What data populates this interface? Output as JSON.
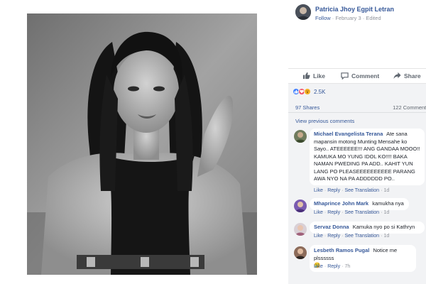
{
  "post": {
    "author": "Patricia Jhoy Egpit Letran",
    "follow": "Follow",
    "date": "February 3",
    "edited": "Edited",
    "meta_dot": "·"
  },
  "actions": {
    "like": "Like",
    "comment": "Comment",
    "share": "Share"
  },
  "stats": {
    "reaction_count": "2.5K",
    "shares": "97 Shares",
    "comments": "122 Comments"
  },
  "view_previous": "View previous comments",
  "comment_actions": {
    "like": "Like",
    "reply": "Reply",
    "see_translation": "See Translation",
    "dot": "·"
  },
  "comments": [
    {
      "name": "Michael Evangelista Terana",
      "text": "Ate sana mapansin motong Munting Mensahe ko Sayo.. ATEEEEEE!!! ANG GANDAA MOOO!! KAMUKA MO YUNG IDOL KO!!!! BAKA NAMAN PWEDING PA ADD.. KAHIT YUN LANG PO PLEASEEEEEEEEEE PARANG AWA NYO NA PA ADDDDDD PO..",
      "time": "1d"
    },
    {
      "name": "Mhaprince John Mark",
      "text": "kamukha nya",
      "time": "1d"
    },
    {
      "name": "Servaz Donna",
      "text": "Kamuka nyo po si Kathryn",
      "time": "1d"
    },
    {
      "name": "Lesbeth Ramos Pugal",
      "text": "Notice me plssssss",
      "emoji": "😢",
      "time": "7h"
    }
  ],
  "colors": {
    "link": "#365899",
    "meta": "#90949c",
    "engagement_bg": "#f2f3f5",
    "like_reaction": "#4080ff",
    "love_reaction": "#f25268",
    "wow_reaction": "#f7b125"
  },
  "icons": {
    "like": "thumbs-up-icon",
    "comment": "speech-bubble-icon",
    "share": "share-arrow-icon"
  }
}
